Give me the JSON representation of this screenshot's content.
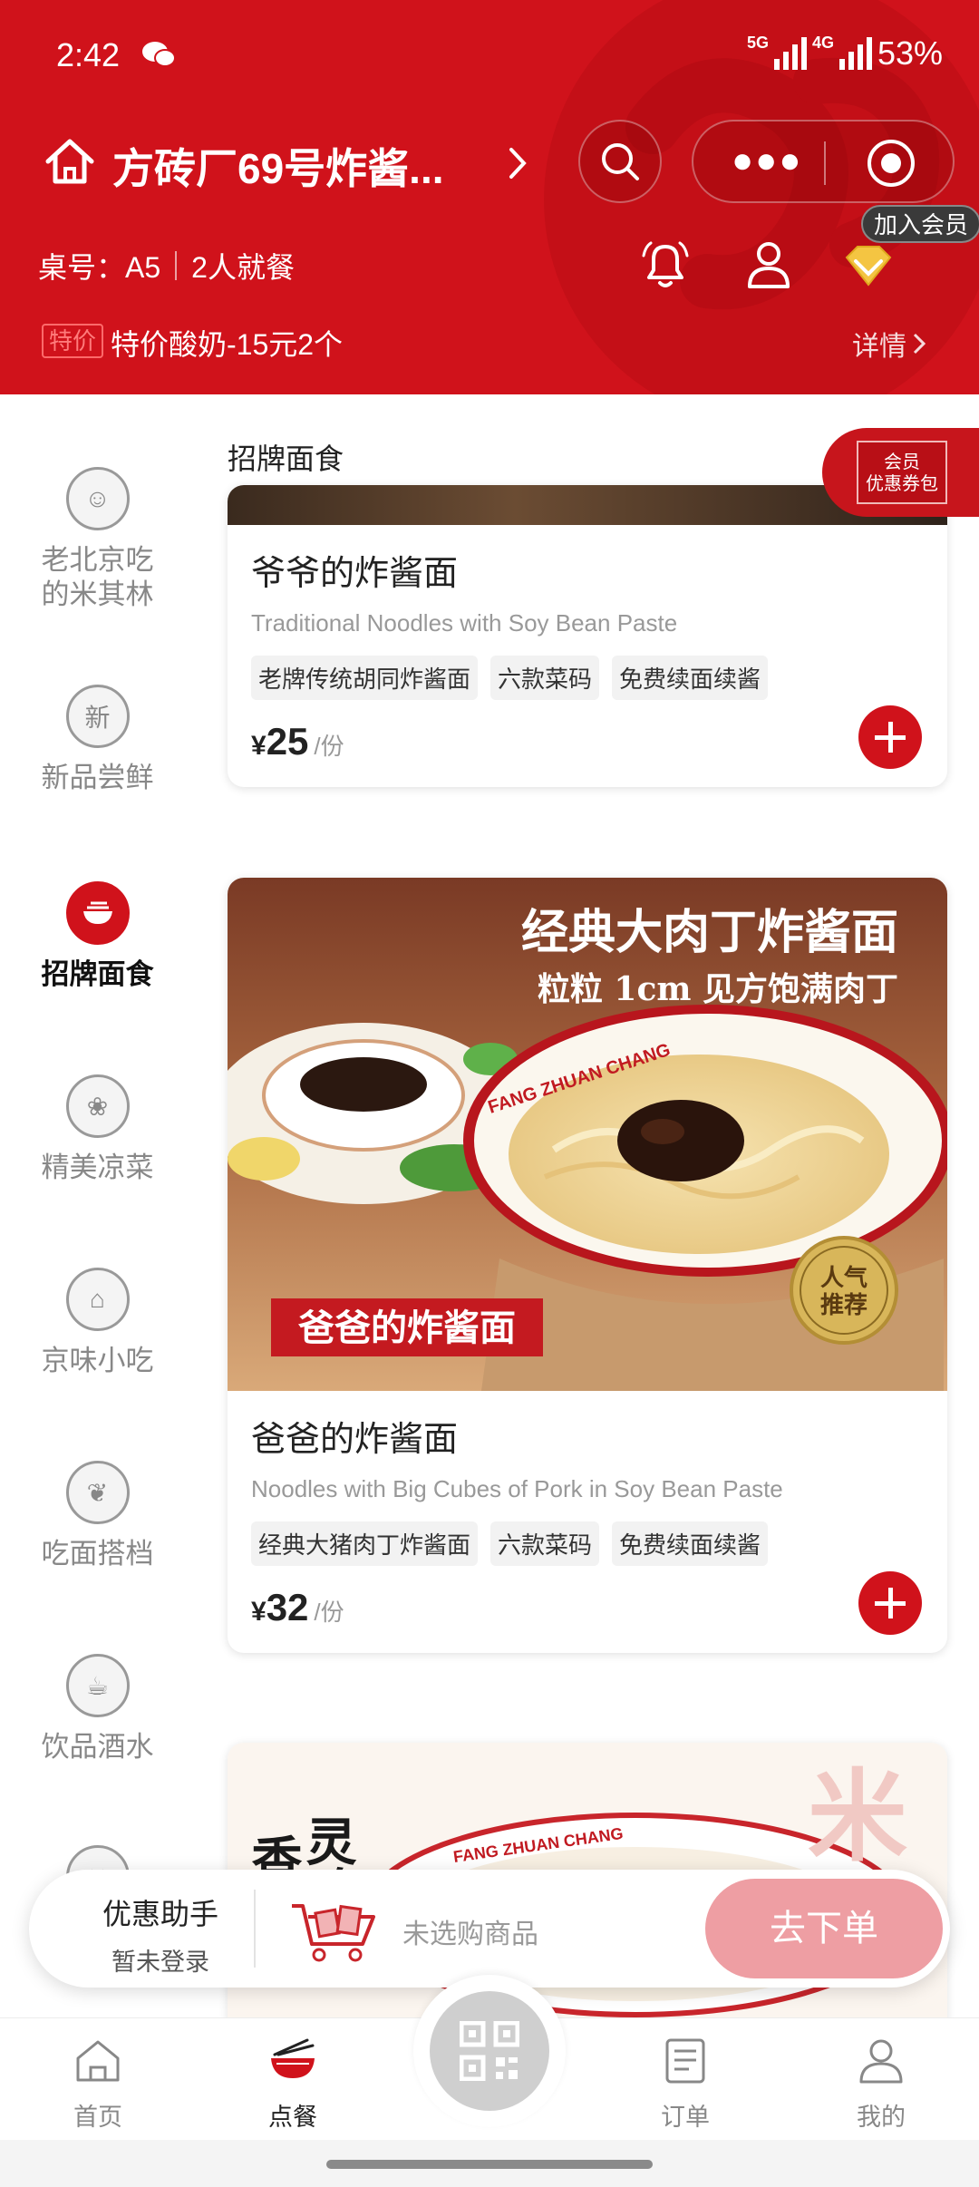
{
  "status_bar": {
    "time": "2:42",
    "net1": "5G",
    "net2": "4G",
    "battery": "53%"
  },
  "header": {
    "store_name": "方砖厂69号炸酱...",
    "member_tip": "加入会员",
    "table": "桌号：A5",
    "diners": "2人就餐",
    "promo_tag": "特价",
    "promo_text": "特价酸奶-15元2个",
    "promo_detail": "详情"
  },
  "coupon_badge": {
    "line1": "会员",
    "line2": "优惠券包"
  },
  "sidebar": {
    "categories": [
      {
        "label": "老北京吃的米其林",
        "icon": "bun-mascot-icon"
      },
      {
        "label": "新品尝鲜",
        "icon": "new-badge-icon"
      },
      {
        "label": "招牌面食",
        "icon": "noodle-bowl-icon",
        "active": true
      },
      {
        "label": "精美凉菜",
        "icon": "salad-icon"
      },
      {
        "label": "京味小吃",
        "icon": "temple-icon"
      },
      {
        "label": "吃面搭档",
        "icon": "garlic-icon"
      },
      {
        "label": "饮品酒水",
        "icon": "cup-icon"
      }
    ]
  },
  "menu": {
    "section_title": "招牌面食",
    "items": [
      {
        "name": "爷爷的炸酱面",
        "name_en": "Traditional Noodles with Soy Bean Paste",
        "tags": [
          "老牌传统胡同炸酱面",
          "六款菜码",
          "免费续面续酱"
        ],
        "currency": "¥",
        "price": "25",
        "unit": "/份"
      },
      {
        "name": "爸爸的炸酱面",
        "name_en": "Noodles with Big Cubes of Pork in Soy Bean Paste",
        "tags": [
          "经典大猪肉丁炸酱面",
          "六款菜码",
          "免费续面续酱"
        ],
        "currency": "¥",
        "price": "32",
        "unit": "/份",
        "image_headline": "经典大肉丁炸酱面",
        "image_subline": "粒粒 1cm 见方饱满肉丁",
        "image_label": "爸爸的炸酱面",
        "image_bowl_text": "FANG ZHUAN CHANG",
        "image_badge_top": "人气",
        "image_badge_bottom": "推荐"
      },
      {
        "image_text_a": "香醇",
        "image_text_b": "灵魂",
        "image_bowl_text": "FANG ZHUAN CHANG"
      }
    ]
  },
  "cart": {
    "helper_title": "优惠助手",
    "helper_sub": "暂未登录",
    "empty_text": "未选购商品",
    "checkout": "去下单"
  },
  "tabbar": [
    {
      "label": "首页",
      "icon": "home-icon"
    },
    {
      "label": "点餐",
      "icon": "noodle-order-icon",
      "active": true
    },
    {
      "label": "订单",
      "icon": "order-list-icon"
    },
    {
      "label": "我的",
      "icon": "profile-icon"
    }
  ],
  "colors": {
    "brand_red": "#d0121b",
    "checkout_pink": "#ee9ea3"
  }
}
